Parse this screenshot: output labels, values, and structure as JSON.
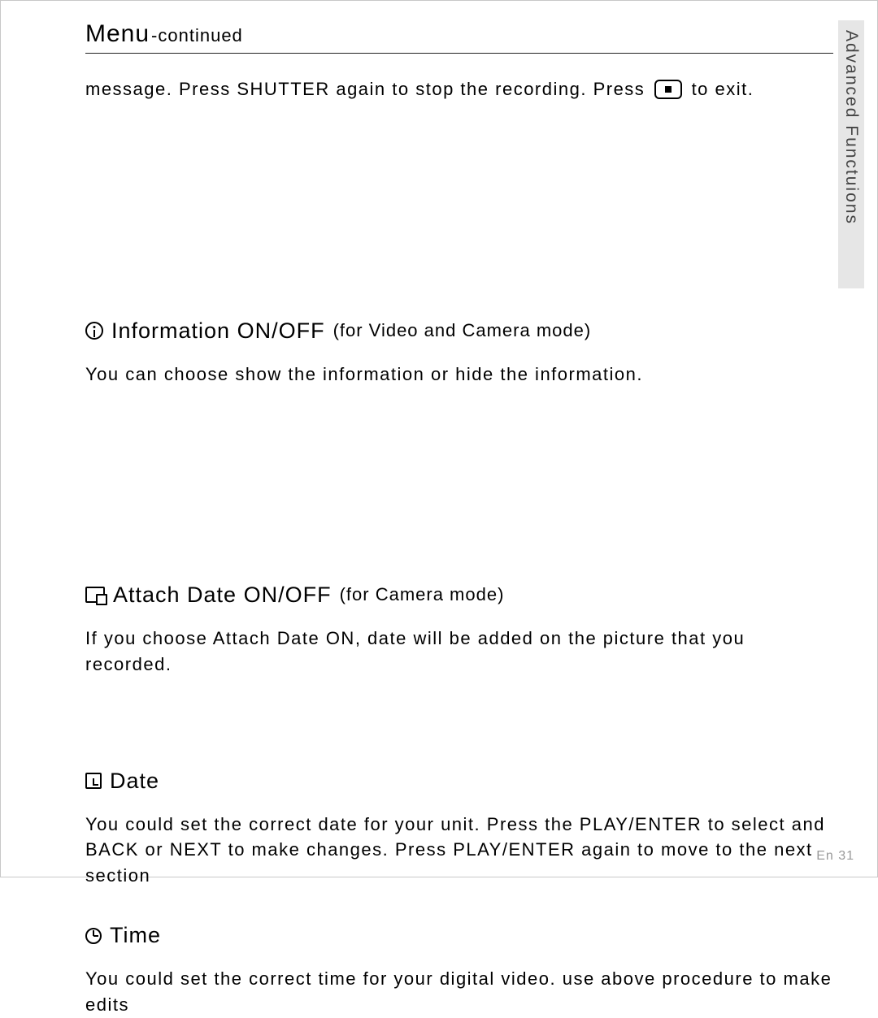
{
  "sidebar": {
    "label": "Advanced Functuions"
  },
  "header": {
    "title": "Menu",
    "subtitle": "-continued"
  },
  "intro": {
    "part1": "message. Press SHUTTER again to stop the recording. Press",
    "part2": "to exit."
  },
  "sections": {
    "info": {
      "title": "Information ON/OFF",
      "mode": "(for Video and Camera mode)",
      "body": "You can choose show the information or hide the information."
    },
    "attach": {
      "title": "Attach Date ON/OFF",
      "mode": "(for Camera mode)",
      "body": "If you choose Attach Date ON, date will be added on the picture that you recorded."
    },
    "date": {
      "title": "Date",
      "body": "You could set the correct date for your unit. Press the PLAY/ENTER to select and BACK or NEXT to make changes.  Press PLAY/ENTER again to move to the next section"
    },
    "time": {
      "title": "Time",
      "body": "You could set the correct time for your digital video. use above procedure to make edits"
    }
  },
  "footer": {
    "page": "En 31"
  }
}
